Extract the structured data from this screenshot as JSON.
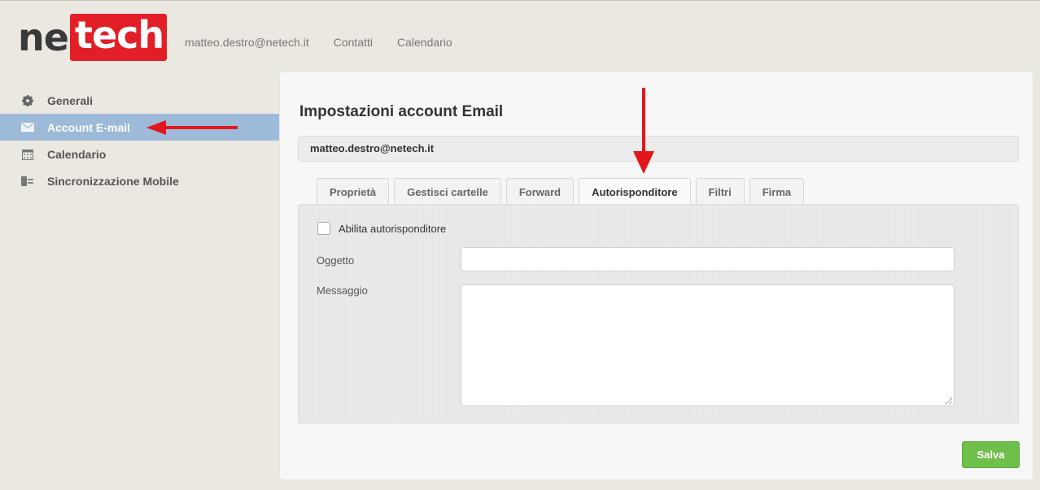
{
  "header": {
    "logo_left": "ne",
    "logo_right": "tech",
    "nav": [
      "matteo.destro@netech.it",
      "Contatti",
      "Calendario"
    ]
  },
  "sidebar": {
    "items": [
      {
        "label": "Generali",
        "icon": "gear-icon"
      },
      {
        "label": "Account E-mail",
        "icon": "envelope-icon",
        "active": true
      },
      {
        "label": "Calendario",
        "icon": "calendar-icon"
      },
      {
        "label": "Sincronizzazione Mobile",
        "icon": "mobile-sync-icon"
      }
    ]
  },
  "main": {
    "title": "Impostazioni account Email",
    "account": "matteo.destro@netech.it",
    "tabs": [
      "Proprietà",
      "Gestisci cartelle",
      "Forward",
      "Autorisponditore",
      "Filtri",
      "Firma"
    ],
    "active_tab": "Autorisponditore",
    "enable_label": "Abilita autorisponditore",
    "subject_label": "Oggetto",
    "subject_value": "",
    "message_label": "Messaggio",
    "message_value": "",
    "save_label": "Salva"
  },
  "colors": {
    "brand_red": "#e21f26",
    "sidebar_active": "#9dbad9",
    "save_green": "#6fbf4b",
    "annotation_arrow": "#e3161b"
  }
}
